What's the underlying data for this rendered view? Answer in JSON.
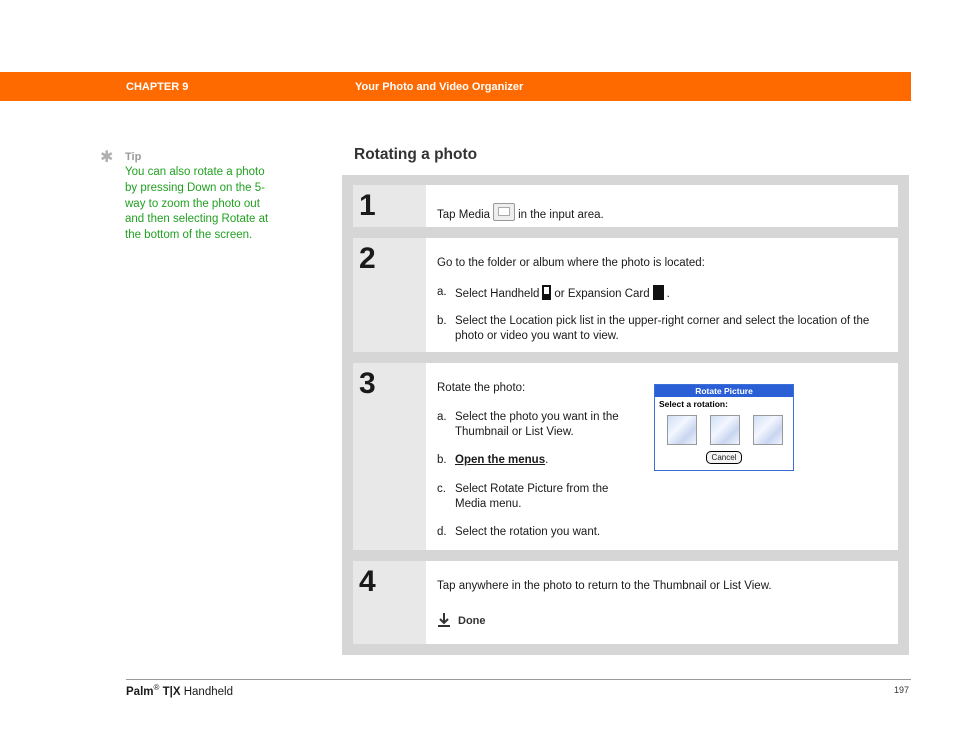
{
  "header": {
    "chapter": "CHAPTER 9",
    "title": "Your Photo and Video Organizer",
    "bar_color": "#ff6a00"
  },
  "tip": {
    "icon": "asterisk-icon",
    "label": "Tip",
    "text": "You can also rotate a photo by pressing Down on the 5-way to zoom the photo out and then selecting Rotate at the bottom of the screen."
  },
  "section_title": "Rotating a photo",
  "steps": [
    {
      "number": "1",
      "text_before": "Tap Media",
      "text_after": "in the input area."
    },
    {
      "number": "2",
      "intro": "Go to the folder or album where the photo is located:",
      "items": [
        {
          "label": "a.",
          "text_before": "Select Handheld",
          "text_mid": "or Expansion Card",
          "text_after": "."
        },
        {
          "label": "b.",
          "text": "Select the Location pick list in the upper-right corner and select the location of the photo or video you want to view."
        }
      ]
    },
    {
      "number": "3",
      "intro": "Rotate the photo:",
      "items": [
        {
          "label": "a.",
          "text": "Select the photo you want in the Thumbnail or List View."
        },
        {
          "label": "b.",
          "link": "Open the menus",
          "text_after": "."
        },
        {
          "label": "c.",
          "text": "Select Rotate Picture from the Media menu."
        },
        {
          "label": "d.",
          "text": "Select the rotation you want."
        }
      ],
      "dialog": {
        "title": "Rotate Picture",
        "subtitle": "Select a rotation:",
        "button": "Cancel"
      }
    },
    {
      "number": "4",
      "text": "Tap anywhere in the photo to return to the Thumbnail or List View.",
      "done": "Done"
    }
  ],
  "footer": {
    "brand": "Palm",
    "reg": "®",
    "model": "T|X",
    "product": "Handheld",
    "page": "197"
  }
}
